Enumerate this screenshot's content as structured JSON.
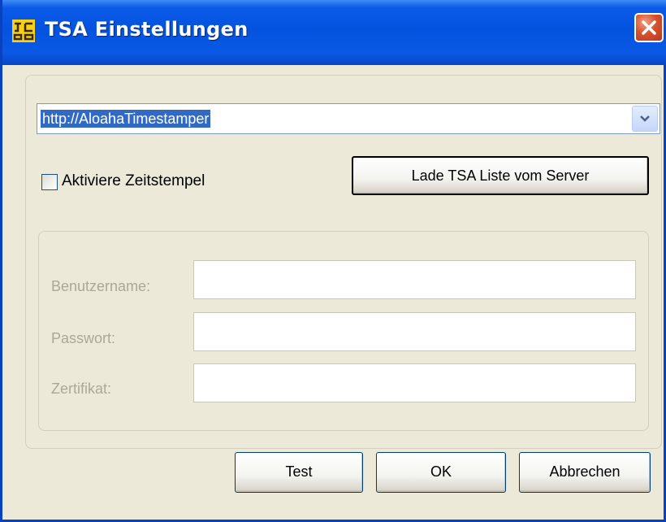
{
  "window": {
    "title": "TSA Einstellungen",
    "icon": "certificate-app-icon",
    "close_icon": "close-x-icon",
    "colors": {
      "titlebar": "#0453e0",
      "background": "#ece9d8",
      "close": "#d6532f",
      "selection": "#316ac5"
    }
  },
  "tsa": {
    "server_url": "http://AloahaTimestamper",
    "dropdown_icon": "chevron-down-icon",
    "enable_label": "Aktiviere Zeitstempel",
    "enable_checked": false,
    "load_button": "Lade TSA Liste vom Server"
  },
  "credentials": {
    "username_label": "Benutzername:",
    "username_value": "",
    "password_label": "Passwort:",
    "password_value": "",
    "certificate_label": "Zertifikat:",
    "certificate_value": "",
    "disabled": true
  },
  "buttons": {
    "test": "Test",
    "ok": "OK",
    "cancel": "Abbrechen"
  }
}
